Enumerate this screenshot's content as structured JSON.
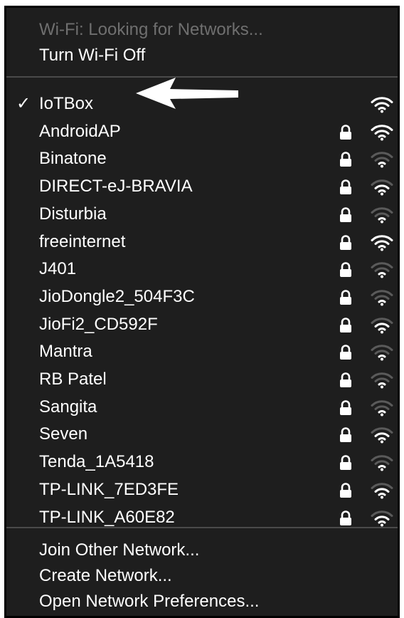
{
  "header": {
    "status": "Wi-Fi: Looking for Networks...",
    "toggle_label": "Turn Wi-Fi Off"
  },
  "networks": [
    {
      "name": "IoTBox",
      "connected": true,
      "locked": false,
      "signal": 3
    },
    {
      "name": "AndroidAP",
      "connected": false,
      "locked": true,
      "signal": 3
    },
    {
      "name": "Binatone",
      "connected": false,
      "locked": true,
      "signal": 1
    },
    {
      "name": "DIRECT-eJ-BRAVIA",
      "connected": false,
      "locked": true,
      "signal": 2
    },
    {
      "name": "Disturbia",
      "connected": false,
      "locked": true,
      "signal": 1
    },
    {
      "name": "freeinternet",
      "connected": false,
      "locked": true,
      "signal": 3
    },
    {
      "name": "J401",
      "connected": false,
      "locked": true,
      "signal": 1
    },
    {
      "name": "JioDongle2_504F3C",
      "connected": false,
      "locked": true,
      "signal": 1
    },
    {
      "name": "JioFi2_CD592F",
      "connected": false,
      "locked": true,
      "signal": 2
    },
    {
      "name": "Mantra",
      "connected": false,
      "locked": true,
      "signal": 1
    },
    {
      "name": "RB Patel",
      "connected": false,
      "locked": true,
      "signal": 1
    },
    {
      "name": "Sangita",
      "connected": false,
      "locked": true,
      "signal": 1
    },
    {
      "name": "Seven",
      "connected": false,
      "locked": true,
      "signal": 2
    },
    {
      "name": "Tenda_1A5418",
      "connected": false,
      "locked": true,
      "signal": 1
    },
    {
      "name": "TP-LINK_7ED3FE",
      "connected": false,
      "locked": true,
      "signal": 2
    },
    {
      "name": "TP-LINK_A60E82",
      "connected": false,
      "locked": true,
      "signal": 2
    }
  ],
  "footer": {
    "join_other": "Join Other Network...",
    "create": "Create Network...",
    "preferences": "Open Network Preferences..."
  },
  "check_glyph": "✓",
  "colors": {
    "menu_bg": "#1e1e1e",
    "text": "#ffffff",
    "dim_text": "#6f6f6f",
    "wifi_strong": "#ffffff",
    "wifi_weak": "#5a5a5a"
  },
  "icons": {
    "connected": "checkmark-icon",
    "secured": "lock-icon",
    "signal": "wifi-signal-icon",
    "annotation": "arrow-icon"
  }
}
